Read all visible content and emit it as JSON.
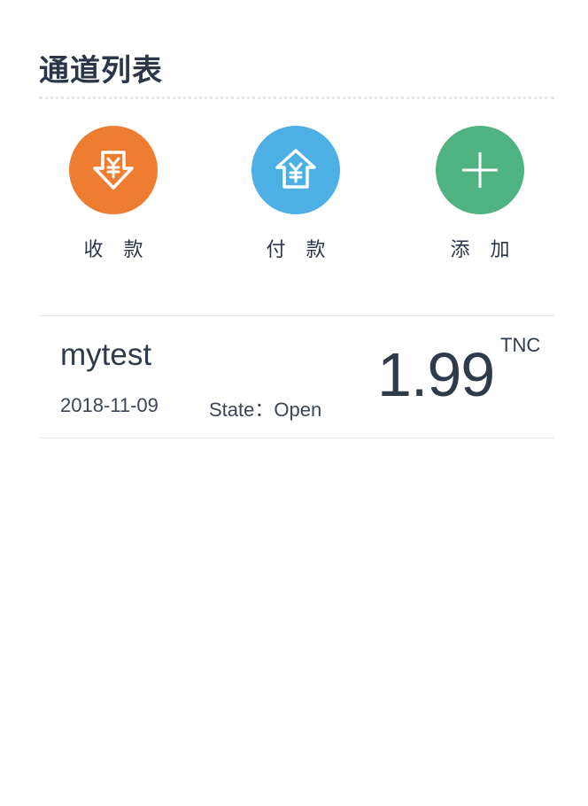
{
  "header": {
    "title": "通道列表"
  },
  "actions": [
    {
      "label": "收 款",
      "icon": "yuan-arrow-down-icon",
      "color": "#ef7d31"
    },
    {
      "label": "付 款",
      "icon": "yuan-house-icon",
      "color": "#4cb0e5"
    },
    {
      "label": "添 加",
      "icon": "plus-icon",
      "color": "#4fb281"
    }
  ],
  "channels": [
    {
      "name": "mytest",
      "date": "2018-11-09",
      "state": "State：Open",
      "amount": "1.99",
      "unit": "TNC"
    }
  ]
}
